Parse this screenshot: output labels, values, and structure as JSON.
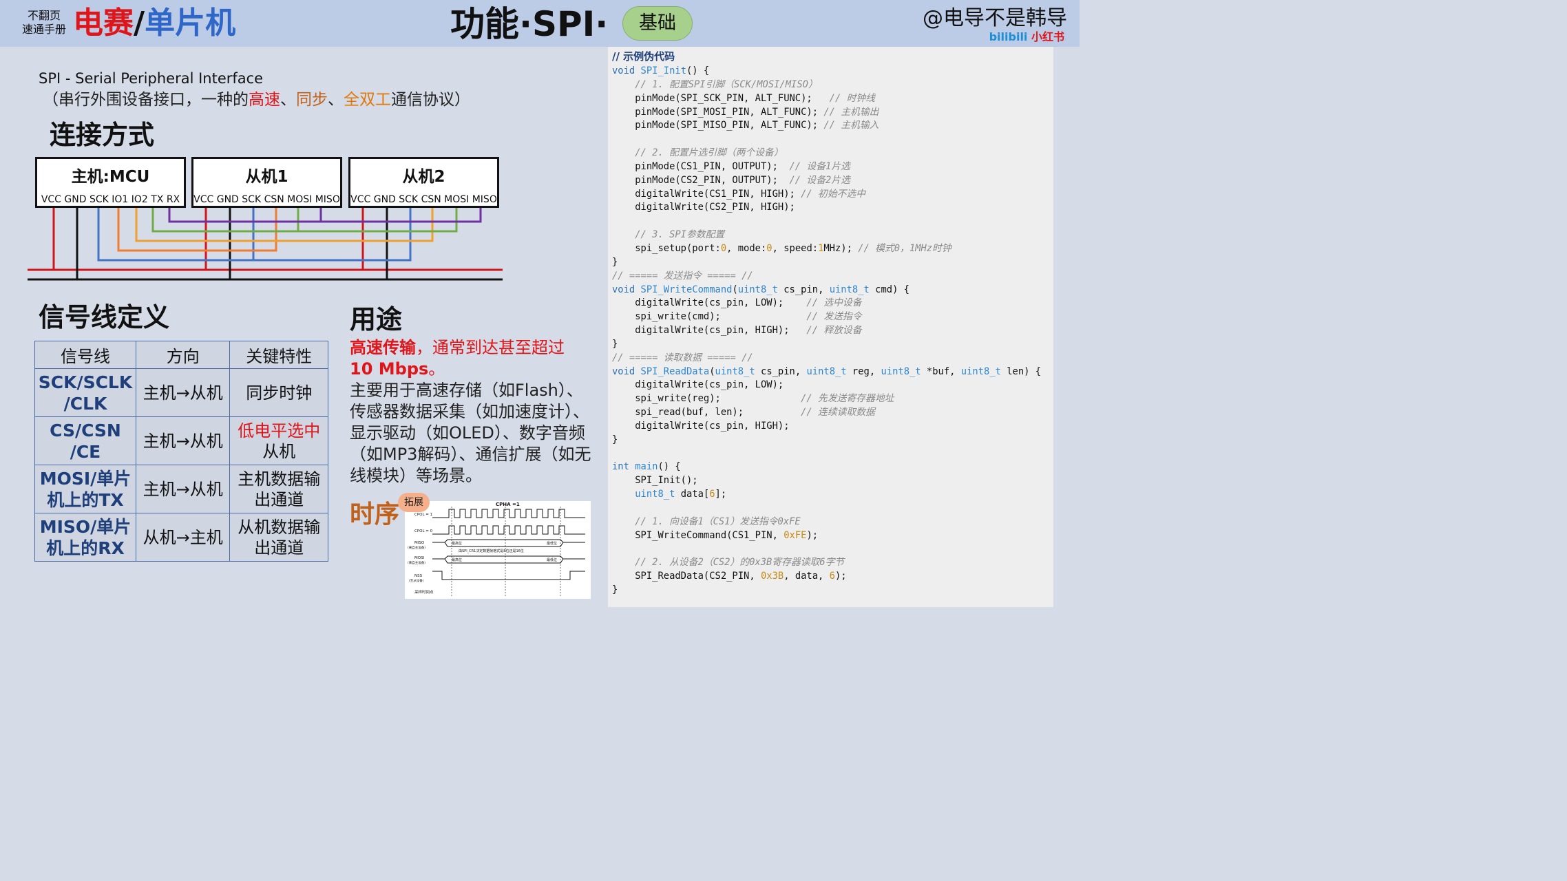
{
  "header": {
    "manual_line1": "不翻页",
    "manual_line2": "速通手册",
    "brand_part1": "电赛",
    "brand_slash": "/",
    "brand_part2": "单片机",
    "title": "功能·SPI·",
    "badge": "基础",
    "author": "@电导不是韩导",
    "platform1": "bilibili",
    "platform2": "小红书"
  },
  "intro": {
    "acronym_line": "SPI - Serial Peripheral Interface",
    "desc_prefix": "（串行外围设备接口，一种的",
    "desc_fast": "高速",
    "desc_sep1": "、",
    "desc_sync": "同步",
    "desc_sep2": "、",
    "desc_duplex": "全双工",
    "desc_suffix": "通信协议）"
  },
  "connection": {
    "heading": "连接方式",
    "devices": [
      {
        "title": "主机:MCU",
        "pins": "VCC GND SCK IO1 IO2 TX RX"
      },
      {
        "title": "从机1",
        "pins": "VCC GND SCK CSN MOSI MISO"
      },
      {
        "title": "从机2",
        "pins": "VCC GND SCK CSN MOSI MISO"
      }
    ],
    "wire_colors": {
      "vcc": "#d0161b",
      "gnd": "#111111",
      "sck": "#4472c4",
      "cs1": "#ed7d31",
      "cs2": "#f0a030",
      "mosi": "#70ad47",
      "miso": "#7030a0"
    }
  },
  "signals": {
    "heading": "信号线定义",
    "columns": [
      "信号线",
      "方向",
      "关键特性"
    ],
    "rows": [
      {
        "name": "SCK/SCLK\n/CLK",
        "dir": "主机→从机",
        "feat": "同步时钟",
        "feat_red": ""
      },
      {
        "name": "CS/CSN\n/CE",
        "dir": "主机→从机",
        "feat": "从机",
        "feat_red": "低电平选中"
      },
      {
        "name": "MOSI/单片\n机上的TX",
        "dir": "主机→从机",
        "feat": "主机数据输\n出通道",
        "feat_red": ""
      },
      {
        "name": "MISO/单片\n机上的RX",
        "dir": "从机→主机",
        "feat": "从机数据输\n出通道",
        "feat_red": ""
      }
    ]
  },
  "usage": {
    "heading": "用途",
    "highlight_bold": "高速传输",
    "highlight_rest": "，通常到达甚至超过",
    "highlight_speed": "10 Mbps",
    "highlight_end": "。",
    "body": "主要用于高速存储（如Flash）、传感器数据采集（如加速度计）、显示驱动（如OLED）、数字音频（如MP3解码）、通信扩展（如无线模块）等场景。"
  },
  "timing": {
    "heading": "时序",
    "badge": "拓展",
    "diagram": {
      "cpha_label": "CPHA =1",
      "cpol1": "CPOL = 1",
      "cpol0": "CPOL = 0",
      "miso": "MISO",
      "miso_sub": "(来自主设备)",
      "mosi": "MOSI",
      "mosi_sub": "(来自主设备)",
      "nss": "NSS",
      "nss_sub": "(至从设备)",
      "sample": "采样时间点",
      "msb": "最高位",
      "lsb": "最低位",
      "note": "由SPI_CR1决定数据帧格式是8位还是16位"
    }
  },
  "code": {
    "title": "// 示例伪代码"
  }
}
